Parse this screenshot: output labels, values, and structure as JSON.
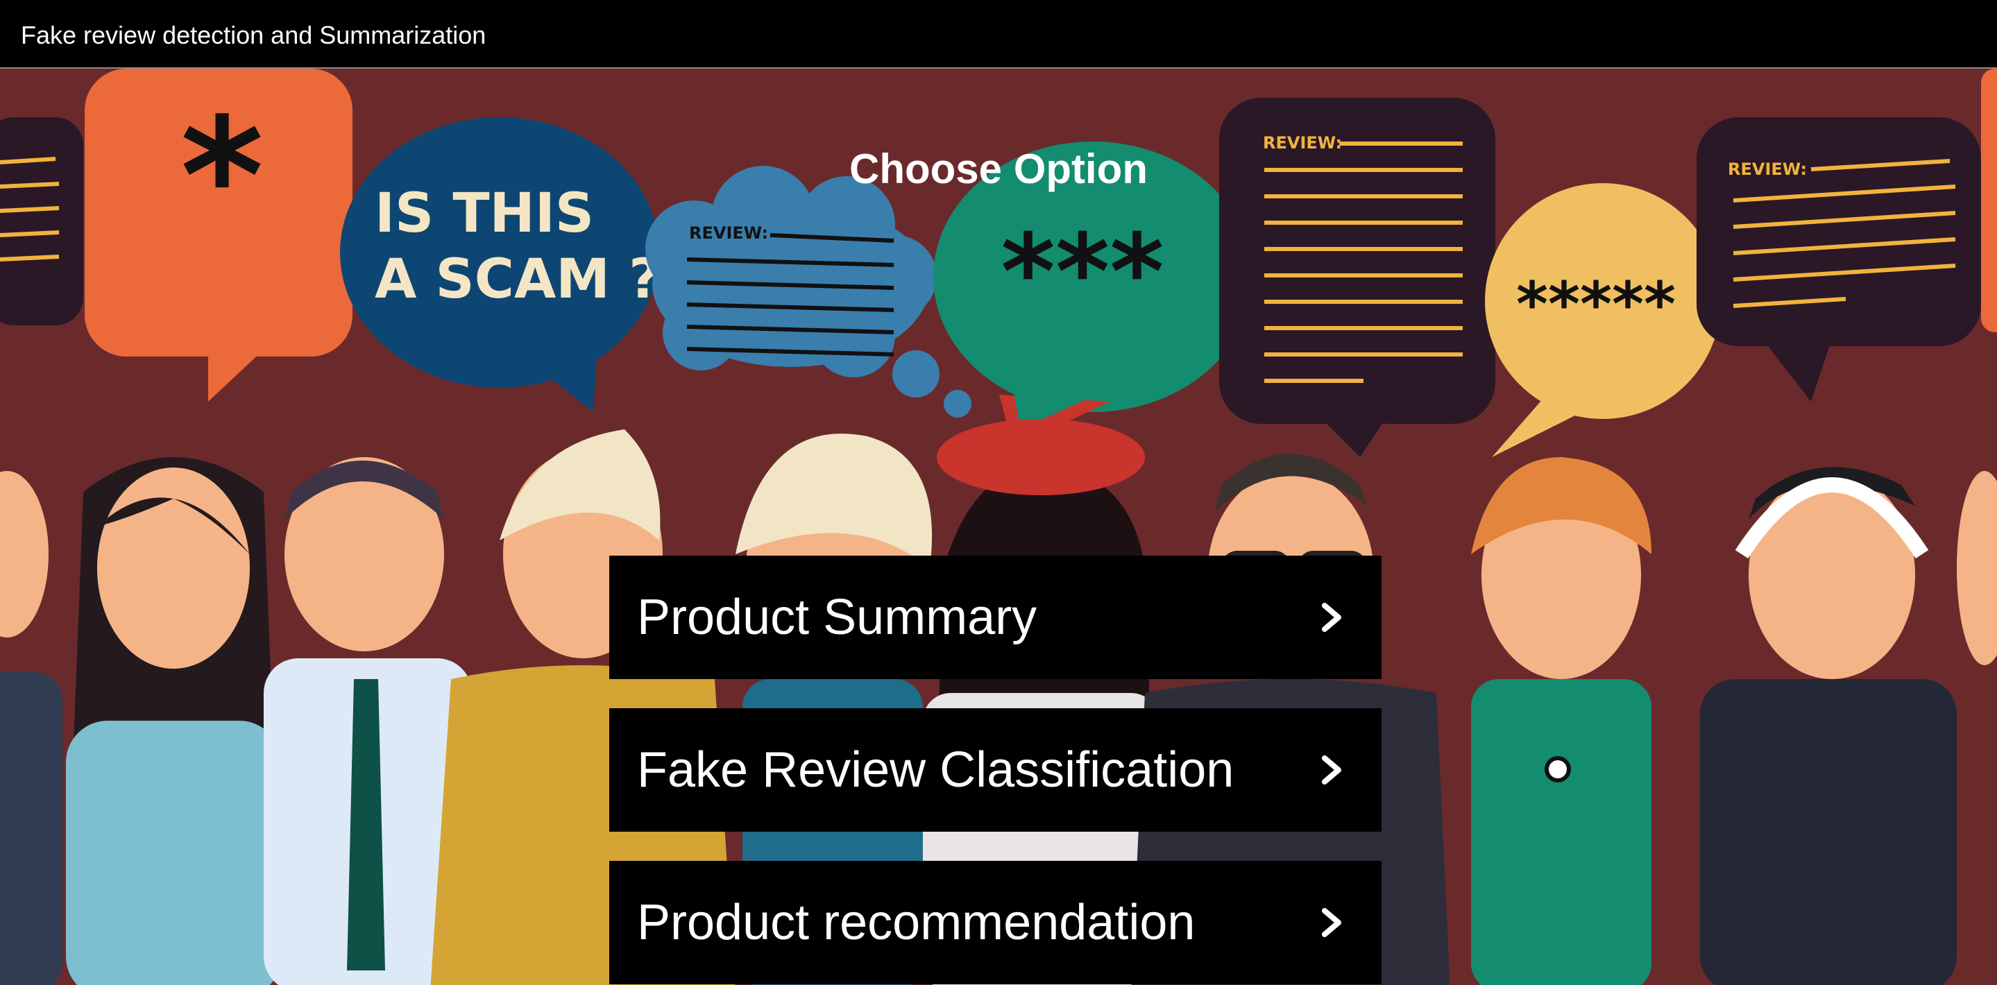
{
  "header": {
    "title": "Fake review detection and Summarization"
  },
  "main": {
    "heading": "Choose Option",
    "options": [
      {
        "label": "Product Summary",
        "icon": "chevron-right-icon"
      },
      {
        "label": "Fake Review Classification",
        "icon": "chevron-right-icon"
      },
      {
        "label": "Product recommendation",
        "icon": "chevron-right-icon"
      }
    ]
  },
  "background_art": {
    "bubble_texts": [
      "*",
      "IS THIS",
      "A SCAM ?",
      "REVIEW:",
      "***",
      "REVIEW:",
      "*****",
      "REVIEW:"
    ]
  },
  "colors": {
    "header_bg": "#000000",
    "hero_bg": "#6a2a2c",
    "option_bg": "#000000",
    "option_text": "#ffffff"
  }
}
